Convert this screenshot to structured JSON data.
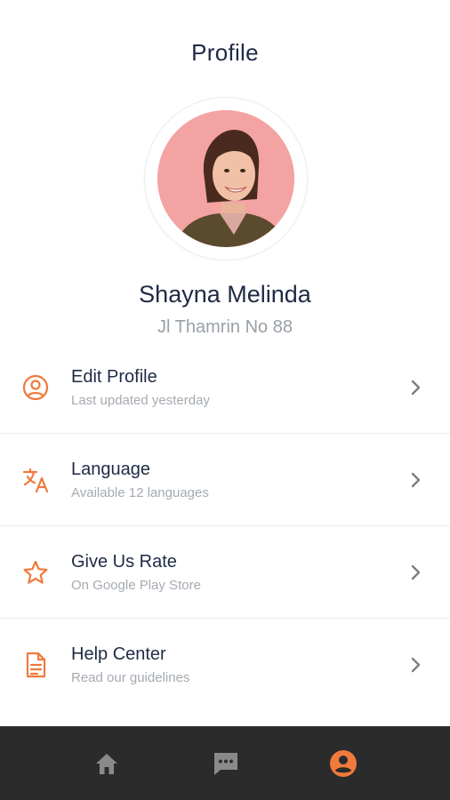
{
  "header": {
    "title": "Profile"
  },
  "profile": {
    "name": "Shayna Melinda",
    "address": "Jl Thamrin No 88"
  },
  "menu": {
    "items": [
      {
        "label": "Edit Profile",
        "subtitle": "Last updated yesterday",
        "icon": "user-circle-icon"
      },
      {
        "label": "Language",
        "subtitle": "Available 12 languages",
        "icon": "translate-icon"
      },
      {
        "label": "Give Us Rate",
        "subtitle": "On Google Play Store",
        "icon": "star-icon"
      },
      {
        "label": "Help Center",
        "subtitle": "Read our guidelines",
        "icon": "document-icon"
      }
    ]
  },
  "bottom_nav": {
    "items": [
      {
        "icon": "home-icon",
        "active": false
      },
      {
        "icon": "chat-icon",
        "active": false
      },
      {
        "icon": "account-icon",
        "active": true
      }
    ]
  },
  "colors": {
    "accent": "#f07a3c",
    "text_primary": "#1f2a44",
    "text_secondary": "#9aa0a8",
    "nav_background": "#2b2b2b",
    "nav_inactive": "#8a8a8a",
    "avatar_background": "#f4a3a3"
  }
}
